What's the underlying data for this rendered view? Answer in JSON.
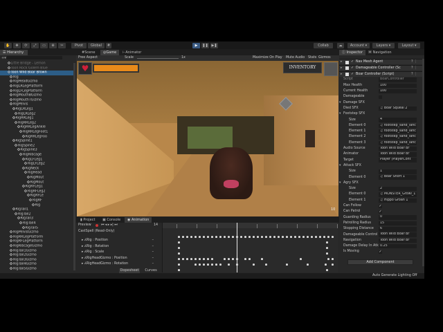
{
  "toolbar": {
    "pivot": "Pivot",
    "global": "Global",
    "collab": "Collab",
    "account": "Account",
    "layers": "Layers",
    "layout": "Layout",
    "tools": [
      "view-hand-icon",
      "move-icon",
      "rotate-icon",
      "scale-icon",
      "rect-icon",
      "transform-icon",
      "custom-tool-icon"
    ]
  },
  "hierarchy": {
    "title": "Hierarchy",
    "items": [
      {
        "label": "Little Bridge - Lemon",
        "indent": 3,
        "dim": true
      },
      {
        "label": "Toon Rock Golem Blue",
        "indent": 3,
        "dim": true
      },
      {
        "label": "Toon Wild Boar Brown",
        "indent": 3,
        "selected": true
      },
      {
        "label": "Rig",
        "indent": 4
      },
      {
        "label": "RigHeadGizmo",
        "indent": 4
      },
      {
        "label": "RigLRLegPlatform",
        "indent": 4
      },
      {
        "label": "RigLFLegPlatform",
        "indent": 4
      },
      {
        "label": "RigMouthBGizmo",
        "indent": 4
      },
      {
        "label": "RigMouthTGizmo",
        "indent": 4
      },
      {
        "label": "RigPelvis",
        "indent": 4
      },
      {
        "label": "RigLRLeg1",
        "indent": 5
      },
      {
        "label": "RigLRLeg2",
        "indent": 6
      },
      {
        "label": "RigRRLeg1",
        "indent": 5
      },
      {
        "label": "RigRRLeg2",
        "indent": 6
      },
      {
        "label": "RigRRLegAnkle",
        "indent": 7
      },
      {
        "label": "RigRRLegFoot1",
        "indent": 8
      },
      {
        "label": "RigRRLegFoo",
        "indent": 9
      },
      {
        "label": "RigSpine1",
        "indent": 5
      },
      {
        "label": "RigSpine2",
        "indent": 6
      },
      {
        "label": "RigSpine3",
        "indent": 7
      },
      {
        "label": "RigRibcage",
        "indent": 8
      },
      {
        "label": "RigLFLeg1",
        "indent": 9
      },
      {
        "label": "RigLFLeg2",
        "indent": 10
      },
      {
        "label": "RigNeck",
        "indent": 9
      },
      {
        "label": "RigHead",
        "indent": 10
      },
      {
        "label": "RigMout",
        "indent": 11
      },
      {
        "label": "RigMout",
        "indent": 11
      },
      {
        "label": "RigRFLeg1",
        "indent": 9
      },
      {
        "label": "RigRFLeg2",
        "indent": 10
      },
      {
        "label": "RigRFLe",
        "indent": 11
      },
      {
        "label": "RigRF",
        "indent": 12
      },
      {
        "label": "Rig",
        "indent": 13
      },
      {
        "label": "RigTail1",
        "indent": 5
      },
      {
        "label": "RigTail2",
        "indent": 6
      },
      {
        "label": "RigTail3",
        "indent": 7
      },
      {
        "label": "RigTail4",
        "indent": 8
      },
      {
        "label": "RigTail5",
        "indent": 9
      },
      {
        "label": "RigPelvisGizmo",
        "indent": 4
      },
      {
        "label": "RigRRLegPlatform",
        "indent": 4
      },
      {
        "label": "RigRFLegPlatform",
        "indent": 4
      },
      {
        "label": "RigRibcageGizmo",
        "indent": 4
      },
      {
        "label": "RigTail1Gizmo",
        "indent": 4
      },
      {
        "label": "RigTail2Gizmo",
        "indent": 4
      },
      {
        "label": "RigTail3Gizmo",
        "indent": 4
      },
      {
        "label": "RigTail4Gizmo",
        "indent": 4
      },
      {
        "label": "RigTail5Gizmo",
        "indent": 4
      }
    ]
  },
  "center": {
    "tabs": [
      "Scene",
      "Game",
      "Animator"
    ],
    "active_tab": "Game",
    "aspect": "Free Aspect",
    "scale_label": "Scale",
    "scale_value": "1x",
    "maximize": "Maximize On Play",
    "mute": "Mute Audio",
    "stats": "Stats",
    "gizmos": "Gizmos"
  },
  "game": {
    "inventory": "INVENTORY",
    "health_fraction": 1.0,
    "fps": "10"
  },
  "animation": {
    "tabs": [
      "Project",
      "Console",
      "Animation"
    ],
    "active_tab": "Animation",
    "preview": "Preview",
    "frame": "14",
    "clip": "CastSpell (Read-Only)",
    "properties": [
      "Rig : Position",
      "Rig : Rotation",
      "Rig : Scale",
      "RigHeadGizmo : Position",
      "RigHeadGizmo : Rotation"
    ],
    "dopesheet": "Dopesheet",
    "curves": "Curves"
  },
  "inspector": {
    "tabs": [
      "Inspector",
      "Navigation"
    ],
    "components": [
      {
        "label": "Nav Mesh Agent"
      },
      {
        "label": "Damageable Controller (Sc"
      },
      {
        "label": "Boar Controller (Script)"
      }
    ],
    "fields": [
      {
        "label": "Script",
        "value": "BoarController",
        "dim": true
      },
      {
        "label": "Max Health",
        "value": "100"
      },
      {
        "label": "Current Health",
        "value": "100"
      },
      {
        "label": "Damageable",
        "check": ""
      },
      {
        "label": "Damage SFX",
        "fold": true
      },
      {
        "label": "Died SFX",
        "value": "♫ Boar Squeal 2"
      },
      {
        "label": "Footstep SFX",
        "fold": true
      },
      {
        "label": "Size",
        "value": "4",
        "sub": true
      },
      {
        "label": "Element 0",
        "value": "♫ footstep_sand_lanc",
        "sub": true
      },
      {
        "label": "Element 1",
        "value": "♫ footstep_sand_lanc",
        "sub": true
      },
      {
        "label": "Element 2",
        "value": "♫ footstep_sand_lanc",
        "sub": true
      },
      {
        "label": "Element 3",
        "value": "♫ footstep_sand_lanc",
        "sub": true
      },
      {
        "label": "Audio Source",
        "value": "Toon Wild Boar Br"
      },
      {
        "label": "Animator",
        "value": "Toon Wild Boar Br"
      },
      {
        "label": "Target",
        "value": "Player (PlayerCont"
      },
      {
        "label": "Attack SFX",
        "fold": true
      },
      {
        "label": "Size",
        "value": "1",
        "sub": true
      },
      {
        "label": "Element 0",
        "value": "♫ Boar Snort 1",
        "sub": true
      },
      {
        "label": "Agry SFX",
        "fold": true
      },
      {
        "label": "Size",
        "value": "2",
        "sub": true
      },
      {
        "label": "Element 0",
        "value": "♫ MONSTER_Growl_1",
        "sub": true
      },
      {
        "label": "Element 1",
        "value": "♫ Hippo Groan 1",
        "sub": true
      },
      {
        "label": "Can Follow",
        "check": "✓"
      },
      {
        "label": "Can Patrol",
        "check": "✓"
      },
      {
        "label": "Guarding Radius",
        "value": "0"
      },
      {
        "label": "Patrolling Radius",
        "value": "15"
      },
      {
        "label": "Stopping Distance",
        "value": "6"
      },
      {
        "label": "Damageable Control",
        "value": "Toon Wild Boar Br"
      },
      {
        "label": "Navigation",
        "value": "Toon Wild Boar Br"
      },
      {
        "label": "Damage Delay In Atk",
        "value": "0.25"
      },
      {
        "label": "Is Moving",
        "check": "✓"
      }
    ],
    "add_component": "Add Component"
  },
  "status": {
    "text": "Auto Generate Lighting Off"
  },
  "colors": {
    "selection": "#2c5d87",
    "play_active": "#3a5a82",
    "health_bar": "#e88a1a"
  }
}
